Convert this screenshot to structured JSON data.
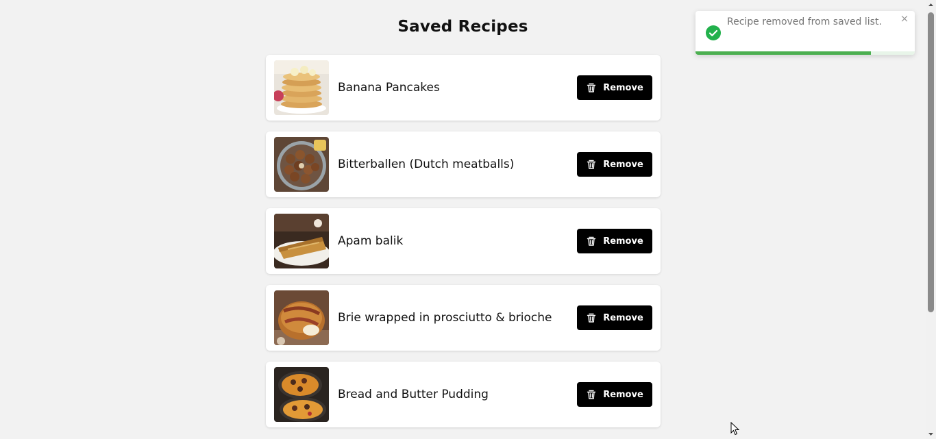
{
  "page": {
    "title": "Saved Recipes"
  },
  "recipes": [
    {
      "name": "Banana Pancakes",
      "remove_label": "Remove"
    },
    {
      "name": "Bitterballen (Dutch meatballs)",
      "remove_label": "Remove"
    },
    {
      "name": "Apam balik",
      "remove_label": "Remove"
    },
    {
      "name": "Brie wrapped in prosciutto & brioche",
      "remove_label": "Remove"
    },
    {
      "name": "Bread and Butter Pudding",
      "remove_label": "Remove"
    }
  ],
  "toast": {
    "message": "Recipe removed from saved list.",
    "close_glyph": "×",
    "progress_fraction": 0.8,
    "icon": "check-circle-icon",
    "accent": "#4caf50"
  },
  "icons": {
    "remove": "trash-icon",
    "close": "close-icon"
  }
}
